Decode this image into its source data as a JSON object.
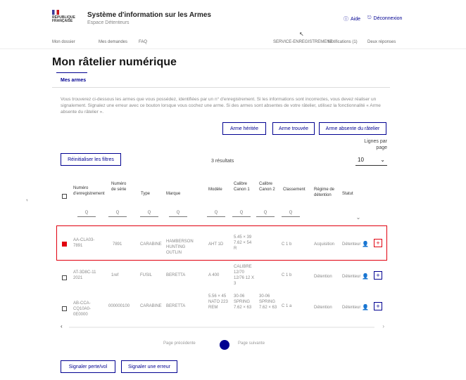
{
  "header": {
    "site_title": "Système d'information sur les Armes",
    "site_subtitle": "Espace Détenteurs",
    "logo_text": "RÉPUBLIQUE FRANÇAISE",
    "link_help": "Aide",
    "link_logout": "Déconnexion"
  },
  "nav": {
    "items": [
      "Mon dossier",
      "Mes demandes",
      "FAQ",
      "SERVICE-ENREGISTREMENT",
      "Notifications (1)",
      "Deux réponses"
    ]
  },
  "page": {
    "title": "Mon râtelier numérique",
    "tab": "Mes armes",
    "description": "Vous trouverez ci-dessous les armes que vous possédez, identifiées par un n° d'enregistrement. Si les informations sont incorrectes, vous devez réaliser un signalement. Signalez une erreur avec ce bouton lorsque vous cochez une arme. Si des armes sont absentes de votre râtelier, utilisez la fonctionnalité « Arme absente du râtelier »."
  },
  "actions": {
    "heritage": "Arme héritée",
    "found": "Arme trouvée",
    "absent": "Arme absente du râtelier",
    "reset_filters": "Réinitialiser les filtres",
    "lines_per_page": "Lignes par page",
    "lines_value": "10",
    "results": "3 résultats",
    "report_loss": "Signaler perte/vol",
    "report_error": "Signaler une erreur"
  },
  "table": {
    "headers": [
      "Numéro d'enregistrement",
      "Numéro de série",
      "Type",
      "Marque",
      "Modèle",
      "Calibre Canon 1",
      "Calibre Canon 2",
      "Classement",
      "Régime de détention",
      "Statut"
    ],
    "filter_placeholder": "Q",
    "rows": [
      {
        "reg": "AA-CLA03-7891",
        "serial": "7891",
        "type": "CARABINE",
        "brand": "HAMBERSON HUNTING OUTLIN",
        "model": "AHT 1D",
        "cal1": "5.45 × 39 7.62 × 54 R",
        "cal2": "",
        "class": "C 1 b",
        "regime": "Acquisition",
        "status": "Détenteur"
      },
      {
        "reg": "AT-3D8C-11 2021",
        "serial": "1ref",
        "type": "FUSIL",
        "brand": "BERETTA",
        "model": "A 400",
        "cal1": "CALIBRE 12/70 12/76 12 X 3",
        "cal2": "",
        "class": "C 1 b",
        "regime": "Détention",
        "status": "Détenteur"
      },
      {
        "reg": "AB-CCA-CQ10A0-0E0000",
        "serial": "000000100",
        "type": "CARABINE",
        "brand": "BERETTA",
        "model": "5.56 × 45 NATO 223 REM",
        "cal1": "30-06 SPRING 7.62 × 63",
        "cal2": "30-06 SPRING 7.62 × 63",
        "class": "C 1 a",
        "regime": "Détention",
        "status": "Détenteur"
      }
    ]
  },
  "pagination": {
    "previous": "Page précédente",
    "next": "Page suivante",
    "current": "1"
  },
  "colors": {
    "primary": "#000091",
    "selection": "#e1000f"
  }
}
